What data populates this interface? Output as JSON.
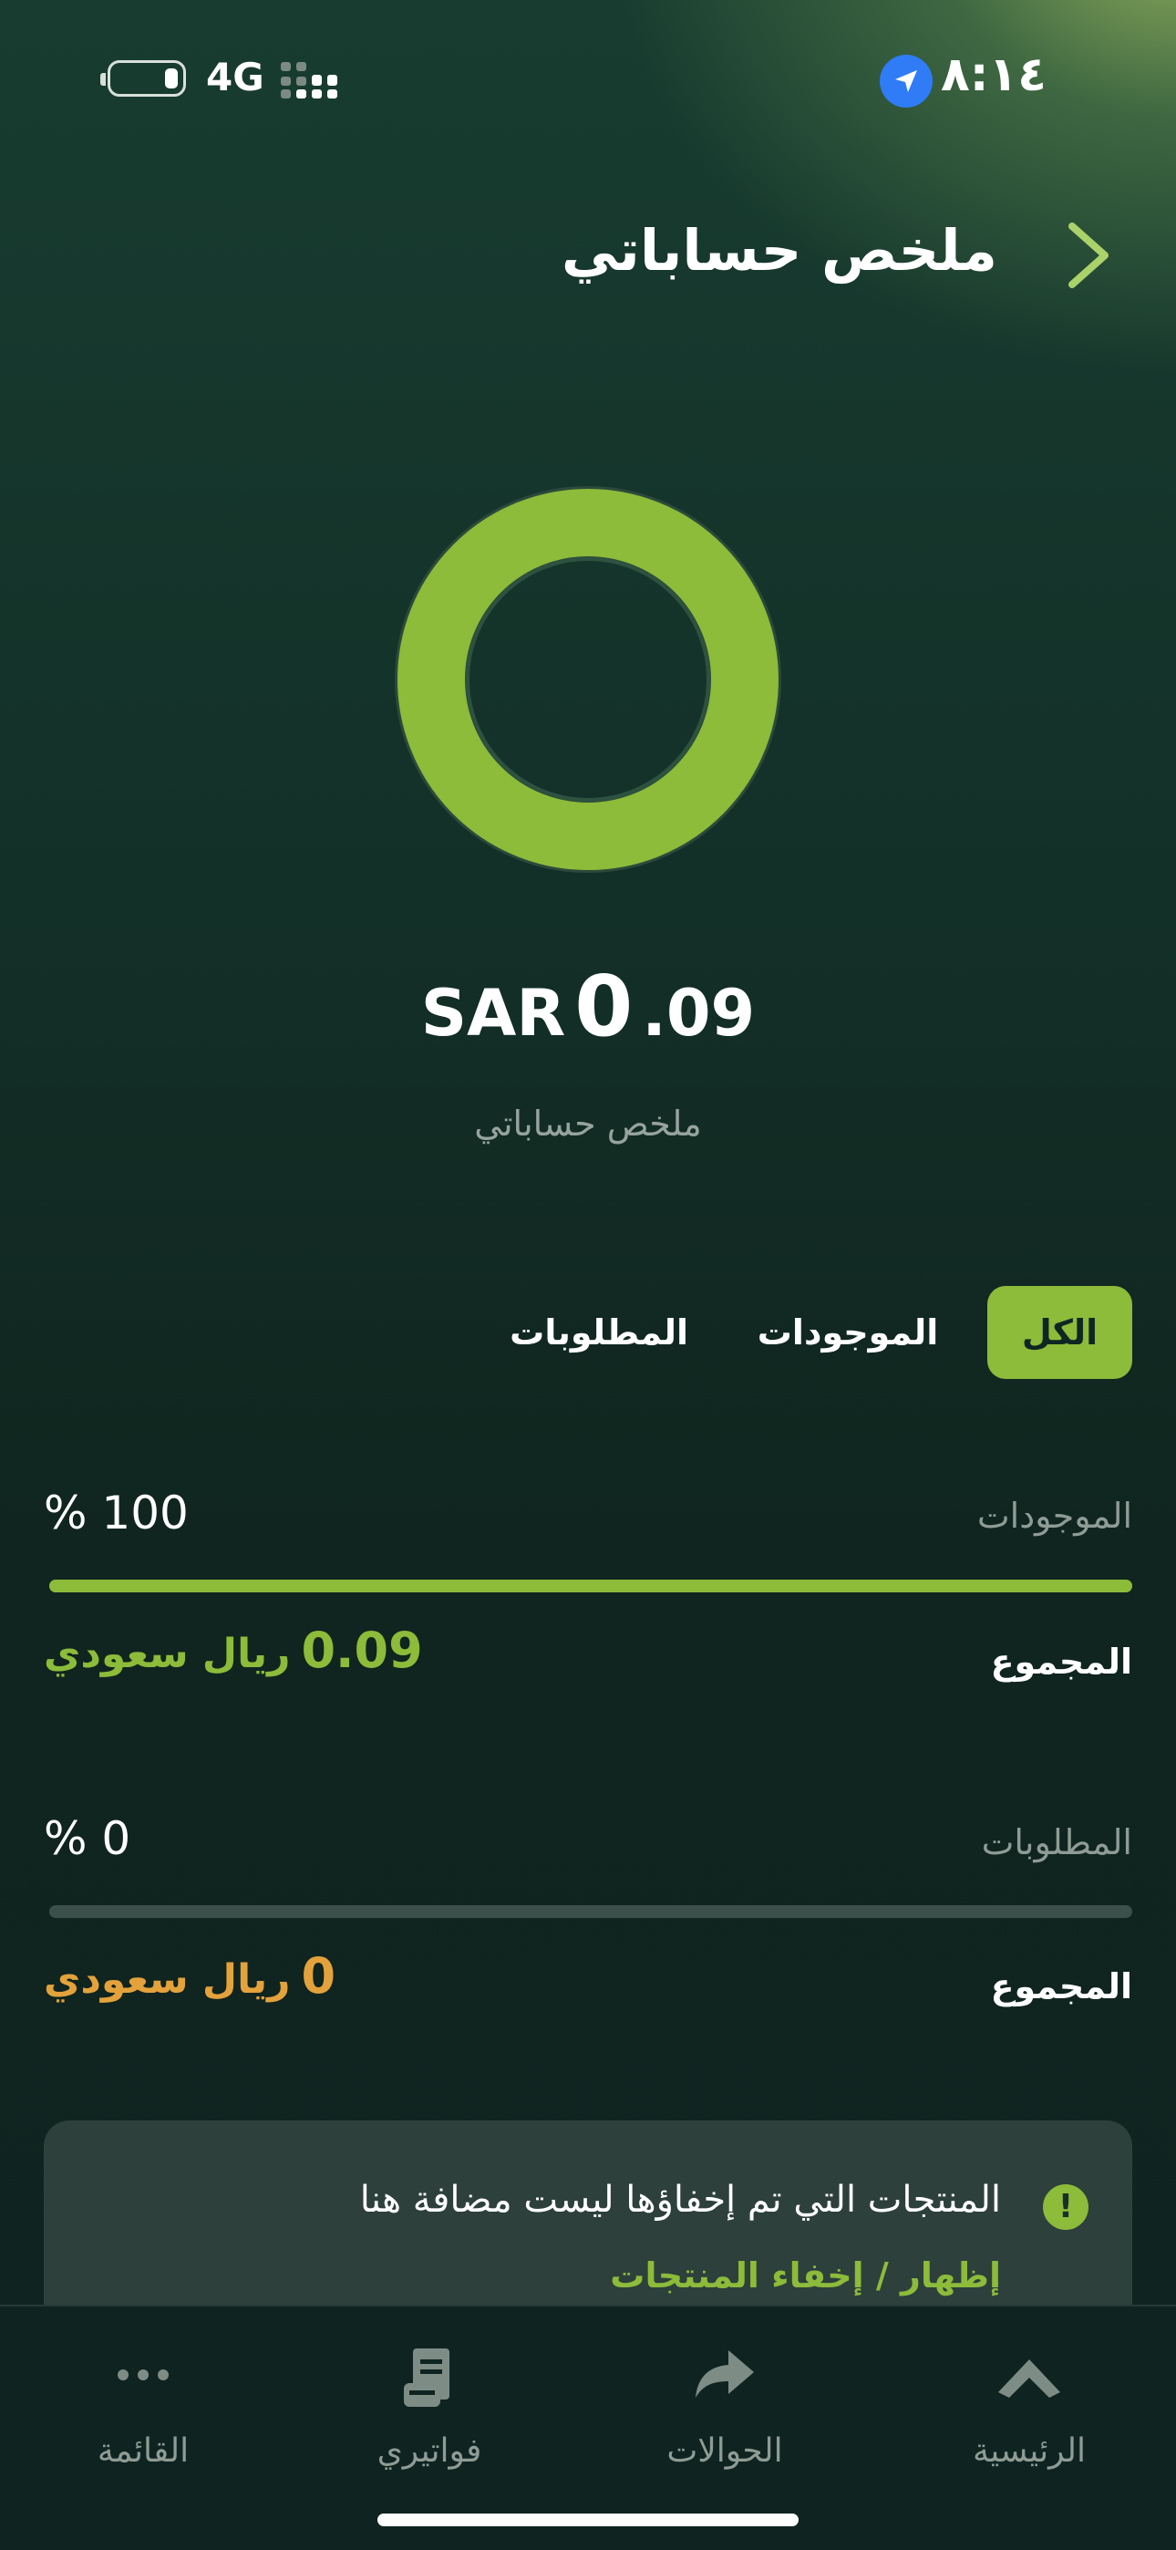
{
  "status_bar": {
    "time": "٨:١٤",
    "network": "4G",
    "icons": [
      "battery-icon",
      "signal-icon",
      "location-icon"
    ]
  },
  "header": {
    "title": "ملخص حساباتي",
    "back_icon": "chevron-right-icon"
  },
  "summary": {
    "donut_assets_fraction": 1.0,
    "currency": "SAR",
    "amount_integer": "0",
    "amount_decimal": ".09",
    "caption": "ملخص حساباتي"
  },
  "tabs": [
    {
      "label": "الكل",
      "active": true
    },
    {
      "label": "الموجودات",
      "active": false
    },
    {
      "label": "المطلوبات",
      "active": false
    }
  ],
  "assets": {
    "label": "الموجودات",
    "percent": "% 100",
    "fraction": 1.0,
    "sum_label": "المجموع",
    "sum_number": "0.09",
    "sum_currency": "ريال سعودي"
  },
  "liabilities": {
    "label": "المطلوبات",
    "percent": "% 0",
    "fraction": 0.0,
    "sum_label": "المجموع",
    "sum_number": "0",
    "sum_currency": "ريال سعودي"
  },
  "info_card": {
    "message": "المنتجات التي تم إخفاؤها ليست مضافة هنا",
    "link": "إظهار / إخفاء المنتجات"
  },
  "bottom_nav": [
    {
      "label": "الرئيسية",
      "icon": "home-icon"
    },
    {
      "label": "الحوالات",
      "icon": "transfer-icon"
    },
    {
      "label": "فواتيري",
      "icon": "bills-icon"
    },
    {
      "label": "القائمة",
      "icon": "more-icon"
    }
  ],
  "colors": {
    "accent_green": "#8dbb3a",
    "liability_orange": "#e3a23b",
    "background": "#0f2722"
  }
}
